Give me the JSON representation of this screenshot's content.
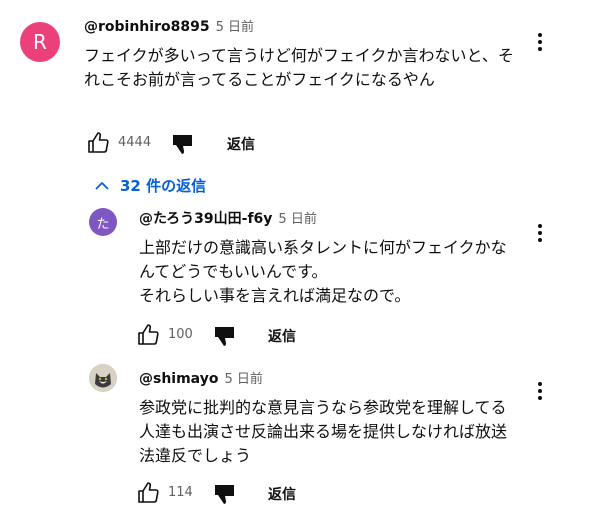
{
  "comment": {
    "avatar_letter": "R",
    "avatar_color": "#ec407a",
    "author": "@robinhiro8895",
    "time": "5 日前",
    "text": "フェイクが多いって言うけど何がフェイクか言わないと、それこそお前が言ってることがフェイクになるやん",
    "likes": "4444",
    "reply_label": "返信"
  },
  "replies_toggle": {
    "label": "32 件の返信",
    "color": "#065fd4"
  },
  "replies": [
    {
      "avatar_letter": "た",
      "avatar_color": "#7e57c2",
      "author": "@たろう39山田-f6y",
      "time": "5 日前",
      "text": "上部だけの意識高い系タレントに何がフェイクかなんてどうでもいいんです。\nそれらしい事を言えれば満足なので。",
      "likes": "100",
      "reply_label": "返信"
    },
    {
      "avatar_icon": "cat-photo-icon",
      "author": "@shimayo",
      "time": "5 日前",
      "text": "参政党に批判的な意見言うなら参政党を理解してる人達も出演させ反論出来る場を提供しなければ放送法違反でしょう",
      "likes": "114",
      "reply_label": "返信"
    }
  ]
}
